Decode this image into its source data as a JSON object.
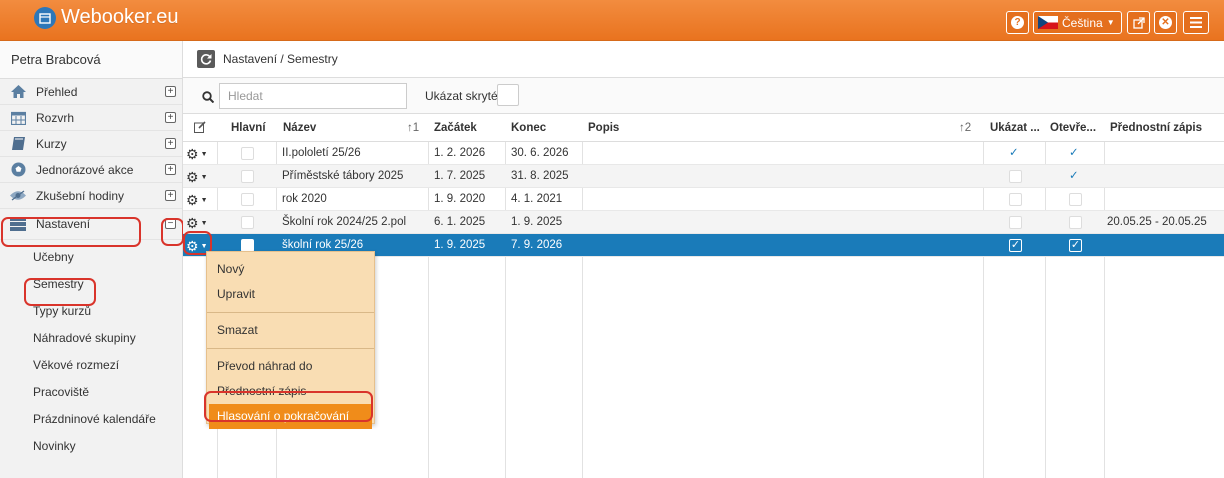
{
  "app": {
    "logo_text": "Webooker.eu",
    "language": "Čeština"
  },
  "colors": {
    "accent": "#ee7f2d",
    "selected_row": "#1a7bb9",
    "highlight": "#d9342b",
    "menu_bg": "#f9ddb3",
    "menu_active": "#f08c1a"
  },
  "sidebar": {
    "user": "Petra Brabcová",
    "items": [
      {
        "label": "Přehled",
        "icon": "home-icon"
      },
      {
        "label": "Rozvrh",
        "icon": "calendar-icon"
      },
      {
        "label": "Kurzy",
        "icon": "book-icon"
      },
      {
        "label": "Jednorázové akce",
        "icon": "soccer-ball-icon"
      },
      {
        "label": "Zkušební hodiny",
        "icon": "eye-icon"
      },
      {
        "label": "Nastavení",
        "icon": "server-icon"
      }
    ],
    "subitems": [
      "Učebny",
      "Semestry",
      "Typy kurzů",
      "Náhradové skupiny",
      "Věkové rozmezí",
      "Pracoviště",
      "Prázdninové kalendáře",
      "Novinky"
    ]
  },
  "breadcrumb": "Nastavení / Semestry",
  "search": {
    "placeholder": "Hledat",
    "hidden_label": "Ukázat skryté:"
  },
  "table": {
    "headers": {
      "hlavni": "Hlavní",
      "nazev": "Název",
      "nazev_sort": "1",
      "zacatek": "Začátek",
      "konec": "Konec",
      "popis": "Popis",
      "popis_sort": "2",
      "ukazat": "Ukázat ...",
      "otevreno": "Otevře...",
      "prednostni": "Přednostní zápis"
    },
    "rows": [
      {
        "nazev": "II.pololetí 25/26",
        "zacatek": "1. 2. 2026",
        "konec": "30. 6. 2026",
        "popis": "",
        "ukazat": true,
        "otevreno": true,
        "prednostni": ""
      },
      {
        "nazev": "Příměstské tábory 2025",
        "zacatek": "1. 7. 2025",
        "konec": "31. 8. 2025",
        "popis": "",
        "ukazat": false,
        "otevreno": true,
        "prednostni": ""
      },
      {
        "nazev": "rok 2020",
        "zacatek": "1. 9. 2020",
        "konec": "4. 1. 2021",
        "popis": "",
        "ukazat": false,
        "otevreno": false,
        "prednostni": ""
      },
      {
        "nazev": "Školní rok 2024/25 2.pol",
        "zacatek": "6. 1. 2025",
        "konec": "1. 9. 2025",
        "popis": "",
        "ukazat": false,
        "otevreno": false,
        "prednostni": "20.05.25 - 20.05.25"
      },
      {
        "nazev": "školní rok 25/26",
        "zacatek": "1. 9. 2025",
        "konec": "7. 9. 2026",
        "popis": "",
        "ukazat": true,
        "otevreno": true,
        "prednostni": ""
      }
    ]
  },
  "context_menu": {
    "items": [
      "Nový",
      "Upravit",
      "Smazat",
      "Převod náhrad do",
      "Přednostní zápis",
      "Hlasování o pokračování"
    ]
  }
}
